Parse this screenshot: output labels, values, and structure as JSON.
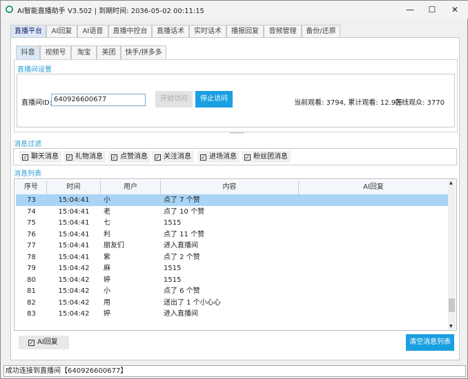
{
  "window": {
    "title": "AI智能直播助手 V3.502 | 到期时间: 2036-05-02 00:11:15",
    "minimize": "—",
    "maximize": "☐",
    "close": "✕"
  },
  "main_tabs": [
    "直播平台",
    "AI回复",
    "AI语音",
    "直播中控台",
    "直播话术",
    "实时话术",
    "播报回复",
    "音频管理",
    "备份/还原"
  ],
  "platform_tabs": [
    "抖音",
    "视频号",
    "淘宝",
    "美团",
    "快手/拼多多"
  ],
  "room_settings": {
    "group_label": "直播间设置",
    "id_label": "直播间ID:",
    "id_value": "640926600677",
    "start_button": "开始访问",
    "stop_button": "停止访问",
    "stats": "当前观看: 3794, 累计观看: 12.9万",
    "online": "在线观众: 3770"
  },
  "splitter": "=====",
  "filter": {
    "group_label": "消息过滤",
    "check_mark": "✓",
    "items": [
      "聊天消息",
      "礼物消息",
      "点赞消息",
      "关注消息",
      "进场消息",
      "粉丝团消息"
    ]
  },
  "message_list": {
    "group_label": "消息列表",
    "columns": [
      "序号",
      "时间",
      "用户",
      "内容",
      "AI回复"
    ],
    "rows": [
      [
        "73",
        "15:04:41",
        "小",
        "点了 7 个赞",
        ""
      ],
      [
        "74",
        "15:04:41",
        "老",
        "点了 10 个赞",
        ""
      ],
      [
        "75",
        "15:04:41",
        "七",
        "1515",
        ""
      ],
      [
        "76",
        "15:04:41",
        "利",
        "点了 11 个赞",
        ""
      ],
      [
        "77",
        "15:04:41",
        "朋友们",
        "进入直播间",
        ""
      ],
      [
        "78",
        "15:04:41",
        "紫",
        "点了 2 个赞",
        ""
      ],
      [
        "79",
        "15:04:42",
        "麻",
        "1515",
        ""
      ],
      [
        "80",
        "15:04:42",
        "婷",
        "1515",
        ""
      ],
      [
        "81",
        "15:04:42",
        "小",
        "点了 6 个赞",
        ""
      ],
      [
        "82",
        "15:04:42",
        "用",
        "送出了 1 个小心心",
        ""
      ],
      [
        "83",
        "15:04:42",
        "婷",
        "进入直播间",
        ""
      ]
    ],
    "selected_row": 0
  },
  "bottom": {
    "ai_reply_checkbox": "AI回复",
    "clear_button": "清空消息列表"
  },
  "status_bar": "成功连接到直播间【640926600677】",
  "colors": {
    "accent": "#1a9fe0",
    "selected_row": "#a9d4f5",
    "group_label": "#2a9fd6"
  }
}
